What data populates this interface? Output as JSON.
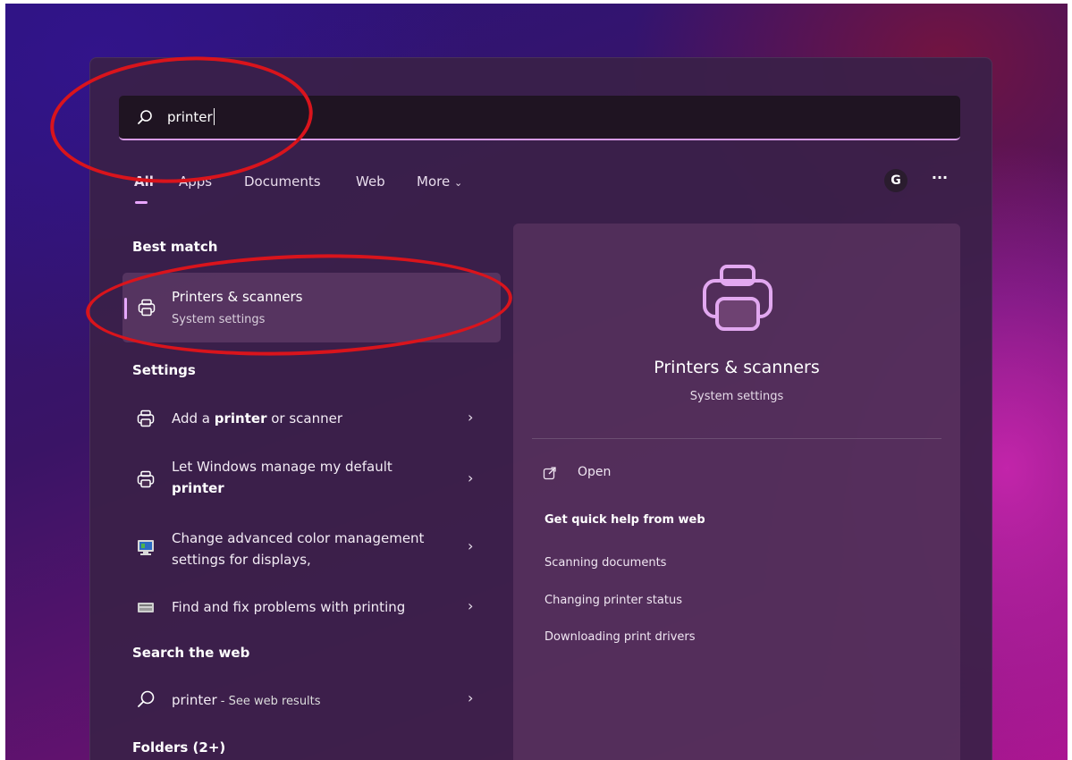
{
  "search": {
    "query": "printer"
  },
  "tabs": [
    {
      "label": "All"
    },
    {
      "label": "Apps"
    },
    {
      "label": "Documents"
    },
    {
      "label": "Web"
    },
    {
      "label": "More"
    }
  ],
  "header": {
    "avatar_initial": "G",
    "more_label": "···"
  },
  "best_match": {
    "section_title": "Best match",
    "title": "Printers & scanners",
    "subtitle": "System settings"
  },
  "settings": {
    "section_title": "Settings",
    "items": [
      {
        "pre": "Add a ",
        "bold": "printer",
        "post": " or scanner",
        "icon": "printer-icon"
      },
      {
        "pre": "Let Windows manage my default ",
        "bold": "printer",
        "post": "",
        "icon": "printer-icon"
      },
      {
        "pre": "Change advanced color management settings for displays,",
        "bold": "",
        "post": "",
        "icon": "monitor-color-icon"
      },
      {
        "pre": "Find and fix problems with printing",
        "bold": "",
        "post": "",
        "icon": "troubleshoot-printer-icon"
      }
    ]
  },
  "web": {
    "section_title": "Search the web",
    "query": "printer",
    "suffix": " - See web results"
  },
  "folders": {
    "section_title": "Folders (2+)"
  },
  "preview": {
    "title": "Printers & scanners",
    "subtitle": "System settings",
    "open_label": "Open",
    "help_title": "Get quick help from web",
    "links": [
      "Scanning documents",
      "Changing printer status",
      "Downloading print drivers"
    ]
  },
  "colors": {
    "accent": "#e7a9ff",
    "annotation": "#d9141c"
  }
}
